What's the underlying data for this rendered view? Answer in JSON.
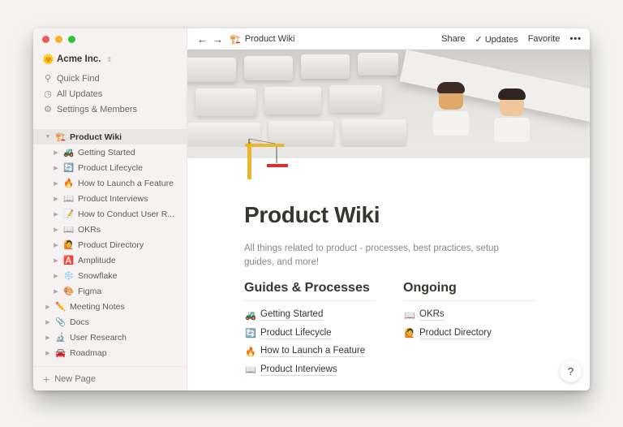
{
  "window": {
    "traffic_lights": [
      "close",
      "minimize",
      "zoom"
    ]
  },
  "sidebar": {
    "workspace": {
      "icon": "🌞",
      "name": "Acme Inc.",
      "switch_icon": "⇕"
    },
    "nav": [
      {
        "icon": "search-icon",
        "glyph": "⚲",
        "label": "Quick Find"
      },
      {
        "icon": "clock-icon",
        "glyph": "◷",
        "label": "All Updates"
      },
      {
        "icon": "gear-icon",
        "glyph": "⚙",
        "label": "Settings & Members"
      }
    ],
    "tree": [
      {
        "level": 0,
        "expanded": true,
        "active": true,
        "emoji": "🏗️",
        "label": "Product Wiki"
      },
      {
        "level": 1,
        "emoji": "🚜",
        "label": "Getting Started"
      },
      {
        "level": 1,
        "emoji": "🔄",
        "label": "Product Lifecycle"
      },
      {
        "level": 1,
        "emoji": "🔥",
        "label": "How to Launch a Feature"
      },
      {
        "level": 1,
        "emoji": "📖",
        "label": "Product Interviews"
      },
      {
        "level": 1,
        "emoji": "📝",
        "label": "How to Conduct User R..."
      },
      {
        "level": 1,
        "emoji": "📖",
        "label": "OKRs"
      },
      {
        "level": 1,
        "emoji": "🙋",
        "label": "Product Directory"
      },
      {
        "level": 1,
        "emoji": "🅰️",
        "label": "Amplitude"
      },
      {
        "level": 1,
        "emoji": "❄️",
        "label": "Snowflake"
      },
      {
        "level": 1,
        "emoji": "🎨",
        "label": "Figma"
      },
      {
        "level": 0,
        "emoji": "✏️",
        "label": "Meeting Notes"
      },
      {
        "level": 0,
        "emoji": "📎",
        "label": "Docs"
      },
      {
        "level": 0,
        "emoji": "🔬",
        "label": "User Research"
      },
      {
        "level": 0,
        "emoji": "🚘",
        "label": "Roadmap"
      }
    ],
    "new_page": {
      "icon": "+",
      "label": "New Page"
    }
  },
  "topbar": {
    "back": "←",
    "forward": "→",
    "breadcrumb": {
      "emoji": "🏗️",
      "label": "Product Wiki"
    },
    "share": "Share",
    "updates_check": "✓",
    "updates": "Updates",
    "favorite": "Favorite",
    "more": "•••"
  },
  "page": {
    "title": "Product Wiki",
    "description": "All things related to product - processes, best practices, setup guides, and more!",
    "columns": [
      {
        "heading": "Guides & Processes",
        "links": [
          {
            "emoji": "🚜",
            "label": "Getting Started"
          },
          {
            "emoji": "🔄",
            "label": "Product Lifecycle"
          },
          {
            "emoji": "🔥",
            "label": "How to Launch a Feature"
          },
          {
            "emoji": "📖",
            "label": "Product Interviews"
          }
        ]
      },
      {
        "heading": "Ongoing",
        "links": [
          {
            "emoji": "📖",
            "label": "OKRs"
          },
          {
            "emoji": "🙋",
            "label": "Product Directory"
          }
        ]
      }
    ],
    "help": "?"
  },
  "colors": {
    "sidebar_bg": "#f7f2f2",
    "text": "#37352f",
    "muted": "#8a8782",
    "traffic_red": "#ee5b55",
    "traffic_yellow": "#f1b22a",
    "traffic_green": "#2fc140"
  }
}
